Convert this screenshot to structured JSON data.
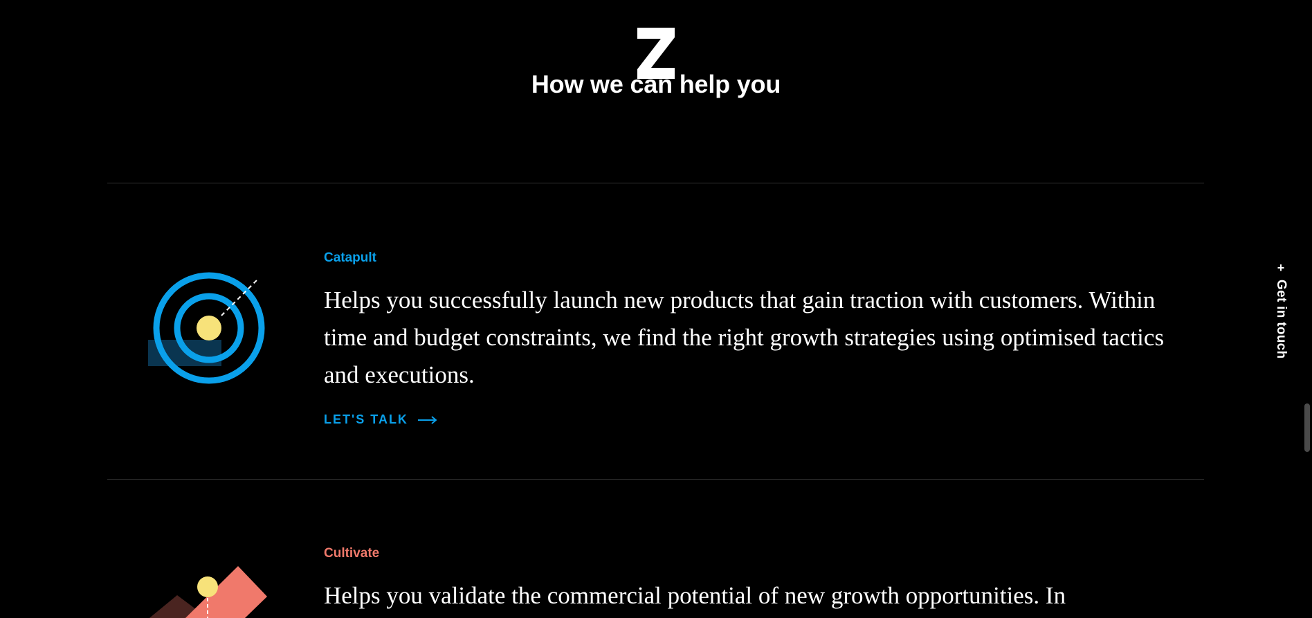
{
  "section": {
    "title": "How we can help you"
  },
  "colors": {
    "background": "#000000",
    "catapult_accent": "#0aa0ea",
    "cultivate_accent": "#f0796b",
    "highlight_yellow": "#f7e27a"
  },
  "services": [
    {
      "label": "Catapult",
      "description": "Helps you successfully launch new products that gain traction with customers. Within time and budget constraints, we find the right growth strategies using optimised tactics and executions.",
      "cta": "LET'S TALK",
      "icon": "target-icon"
    },
    {
      "label": "Cultivate",
      "description": "Helps you validate the commercial potential of new growth opportunities. In",
      "icon": "mountain-icon"
    }
  ],
  "side_cta": {
    "plus": "+",
    "label": "Get in touch"
  }
}
